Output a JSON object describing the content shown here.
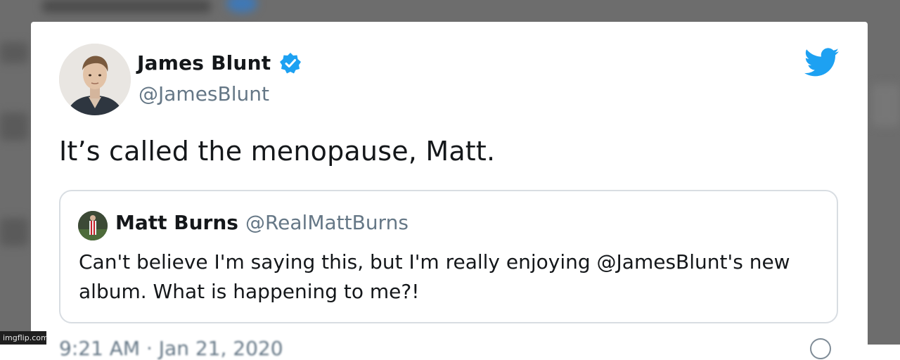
{
  "tweet": {
    "author_name": "James Blunt",
    "author_handle": "@JamesBlunt",
    "verified": true,
    "text": "It’s called the menopause, Matt.",
    "timestamp": "9:21 AM · Jan 21, 2020"
  },
  "quoted_tweet": {
    "author_name": "Matt Burns",
    "author_handle": "@RealMattBurns",
    "text": "Can't believe I'm saying this, but I'm really enjoying @JamesBlunt's new album. What is happening to me?!"
  },
  "icons": {
    "verified": "verified-badge-icon",
    "bird": "twitter-bird-icon",
    "info": "info-icon"
  },
  "colors": {
    "twitter_blue": "#1da1f2",
    "text_primary": "#14171a",
    "text_secondary": "#657786",
    "quote_border": "#d8dde2",
    "backdrop": "#6d6d6d"
  },
  "watermark": "imgflip.com"
}
